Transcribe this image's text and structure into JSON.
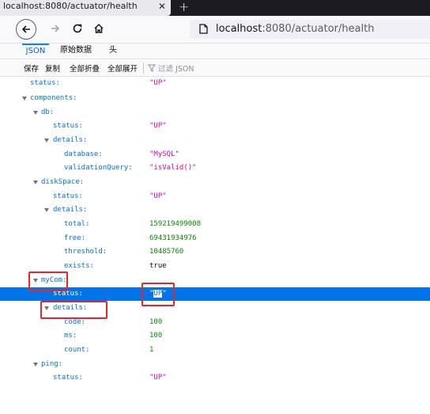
{
  "browser": {
    "tab_title": "localhost:8080/actuator/health",
    "close_glyph": "✕",
    "newtab_glyph": "+",
    "url_host": "localhost",
    "url_rest": ":8080/actuator/health"
  },
  "viewer": {
    "tabs": [
      "JSON",
      "原始数据",
      "头"
    ],
    "active_tab": "JSON"
  },
  "toolbar": {
    "save": "保存",
    "copy": "复制",
    "collapse_all": "全部折叠",
    "expand_all": "全部展开",
    "filter_placeholder": "过滤 JSON"
  },
  "tree": {
    "rows": [
      {
        "key": "status:",
        "value": "\"UP\"",
        "type": "str"
      },
      {
        "key": "components:"
      },
      {
        "key": "db:"
      },
      {
        "key": "status:",
        "value": "\"UP\"",
        "type": "str"
      },
      {
        "key": "details:"
      },
      {
        "key": "database:",
        "value": "\"MySQL\"",
        "type": "str"
      },
      {
        "key": "validationQuery:",
        "value": "\"isValid()\"",
        "type": "str"
      },
      {
        "key": "diskSpace:"
      },
      {
        "key": "status:",
        "value": "\"UP\"",
        "type": "str"
      },
      {
        "key": "details:"
      },
      {
        "key": "total:",
        "value": "159219499008",
        "type": "num"
      },
      {
        "key": "free:",
        "value": "69431934976",
        "type": "num"
      },
      {
        "key": "threshold:",
        "value": "10485760",
        "type": "num"
      },
      {
        "key": "exists:",
        "value": "true",
        "type": "bool"
      },
      {
        "key": "myCom:"
      },
      {
        "key": "status:",
        "value_pre": "\"",
        "value_sel": "UP",
        "value_post": "\"",
        "type": "str",
        "selected": true
      },
      {
        "key": "details:"
      },
      {
        "key": "code:",
        "value": "100",
        "type": "num"
      },
      {
        "key": "ms:",
        "value": "100",
        "type": "num"
      },
      {
        "key": "count:",
        "value": "1",
        "type": "num"
      },
      {
        "key": "ping:"
      },
      {
        "key": "status:",
        "value": "\"UP\"",
        "type": "str"
      }
    ]
  },
  "colors": {
    "key": "#0074e8",
    "string": "#dd00a9",
    "number": "#058b00",
    "selection": "#0074e8",
    "annotation": "#e8242c"
  }
}
